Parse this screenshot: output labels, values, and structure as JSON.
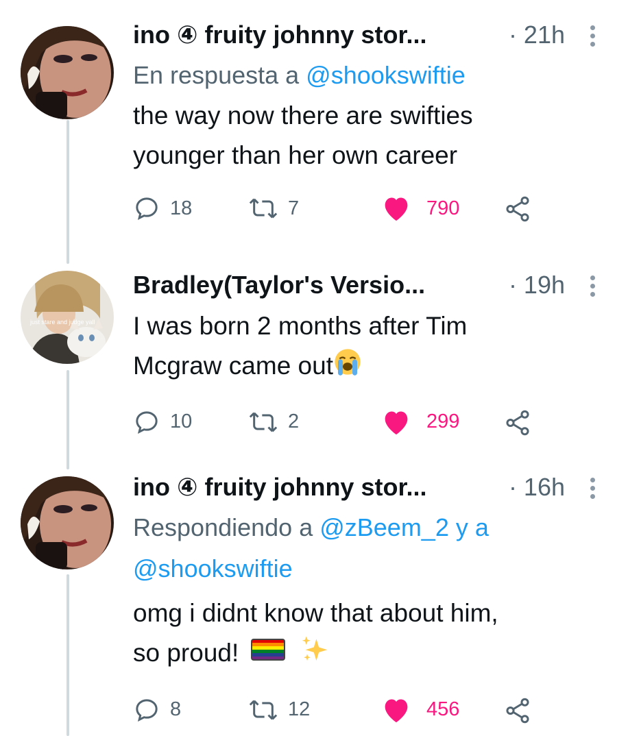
{
  "tweets": [
    {
      "author": "ino ④ fruity johnny stor...",
      "time": "· 21h",
      "reply_prefix": "En respuesta a ",
      "reply_mentions": [
        "@shookswiftie"
      ],
      "text_lines": [
        "the way now there are swifties",
        "younger than her own career"
      ],
      "replies": "18",
      "retweets": "7",
      "likes": "790"
    },
    {
      "author": "Bradley(Taylor's Versio...",
      "time": "· 19h",
      "avatar_caption": "just stare and judge yall",
      "text_lines": [
        "I was born 2 months after Tim",
        "Mcgraw came out"
      ],
      "emoji_1": "loudly-crying-face",
      "replies": "10",
      "retweets": "2",
      "likes": "299"
    },
    {
      "author": "ino ④ fruity johnny stor...",
      "time": "· 16h",
      "reply_prefix": "Respondiendo a ",
      "reply_mentions": [
        "@zBeem_2",
        "@shookswiftie"
      ],
      "reply_join": " y a",
      "text_lines": [
        "omg i didnt know that about him,",
        "so proud!"
      ],
      "emoji_2": [
        "rainbow-flag",
        "sparkles"
      ],
      "replies": "8",
      "retweets": "12",
      "likes": "456"
    }
  ],
  "colors": {
    "mention": "#1d9bf0",
    "like": "#f91880",
    "muted": "#536471",
    "thread_line": "#cfd9de"
  }
}
